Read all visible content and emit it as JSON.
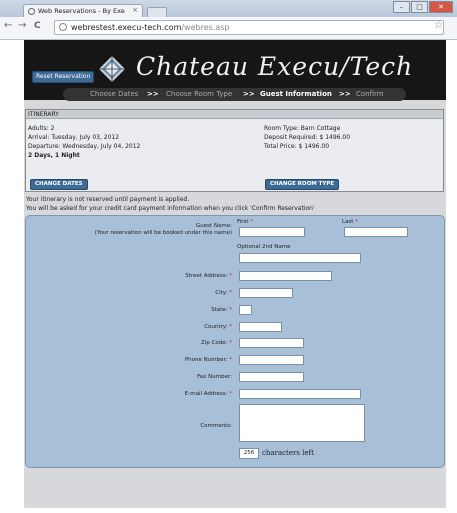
{
  "browser": {
    "tab_title": "Web Reservations - By Exe",
    "tab_close": "×",
    "url_host": "webrestest.execu-tech.com",
    "url_path": "/webres.asp",
    "back": "←",
    "forward": "→",
    "reload": "C",
    "star": "☆"
  },
  "header": {
    "logo_text": "Chateau Execu/Tech"
  },
  "reset_label": "Reset Reservation",
  "steps": {
    "choose_dates": "Choose Dates",
    "choose_room": "Choose Room Type",
    "guest_info": "Guest Information",
    "confirm": "Confirm",
    "separator": ">>"
  },
  "itinerary": {
    "heading": "ITINERARY",
    "adults": "Adults: 2",
    "arrival": "Arrival: Tuesday, July 03, 2012",
    "departure": "Departure: Wednesday, July 04, 2012",
    "duration": "2 Days, 1 Night",
    "room_type": "Room Type: Barn Cottage",
    "deposit": "Deposit Required: $ 1496.00",
    "total": "Total Price: $ 1496.00",
    "change_dates": "CHANGE DATES",
    "change_room": "CHANGE ROOM TYPE"
  },
  "notices": {
    "not_reserved": "Your itinerary is not reserved until payment is applied.",
    "payment_info": "You will be asked for your credit card payment information when you click 'Confirm Reservation'"
  },
  "form": {
    "guest_name": "Guest Name:",
    "booked_note": "(Your reservation will be booked under this name)",
    "first": "First",
    "last": "Last",
    "optional_2nd": "Optional 2nd Name",
    "street": "Street Address:",
    "city": "City:",
    "state": "State:",
    "country": "Country:",
    "zip": "Zip Code:",
    "phone": "Phone Number:",
    "fax": "Fax Number:",
    "email": "E-mail Address:",
    "comments": "Comments:",
    "req_mark": "*",
    "chars_count": "256",
    "chars_left": "characters left"
  }
}
